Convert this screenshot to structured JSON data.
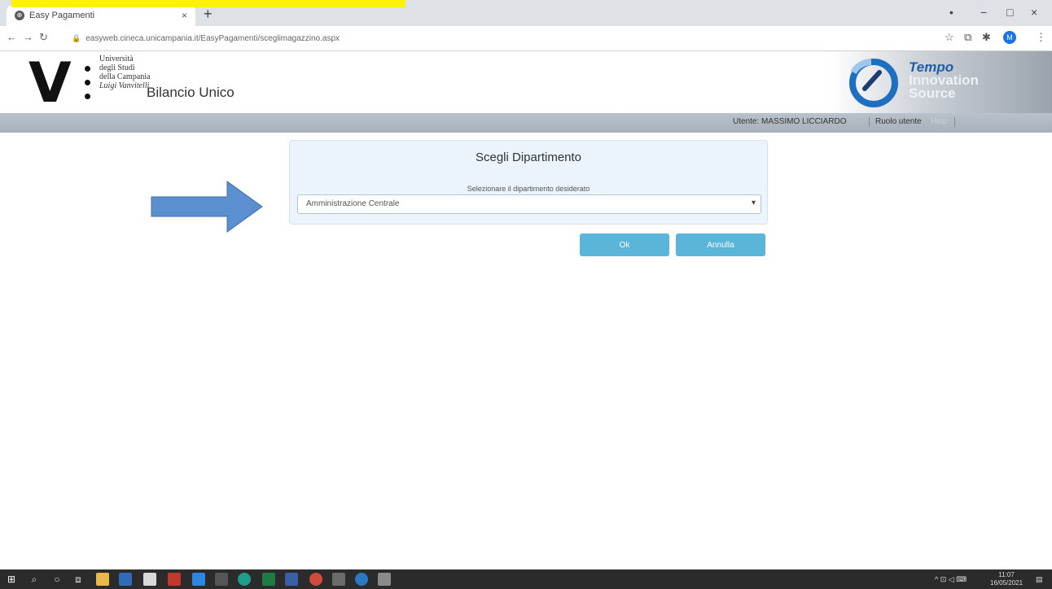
{
  "browser": {
    "tab_title": "Easy Pagamenti",
    "tab_close": "×",
    "new_tab": "+",
    "url": "easyweb.cineca.unicampania.it/EasyPagamenti/sceglimagazzino.aspx",
    "window_controls": [
      "•",
      "−",
      "□",
      "×"
    ],
    "profile_initial": "M"
  },
  "site": {
    "logo_letter": "V",
    "university_lines": [
      "Università",
      "degli Studi",
      "della Campania",
      "Luigi Vanvitelli"
    ],
    "app_title": "Bilancio Unico",
    "brand_lines": [
      "Tempo",
      "Innovation",
      "Source"
    ],
    "user_label": "Utente: MASSIMO LICCIARDO",
    "role_label": "Ruolo utente",
    "help_label": "Help"
  },
  "dialog": {
    "title": "Scegli Dipartimento",
    "hint": "Selezionare il dipartimento desiderato",
    "select_value": "Amministrazione Centrale",
    "ok_label": "Ok",
    "cancel_label": "Annulla"
  },
  "taskbar": {
    "time": "11:07",
    "date": "16/05/2021"
  },
  "colors": {
    "button": "#5bb5d9",
    "dialog_bg": "#eaf4fa",
    "arrow": "#5b8fd0",
    "highlight": "#fff200"
  }
}
